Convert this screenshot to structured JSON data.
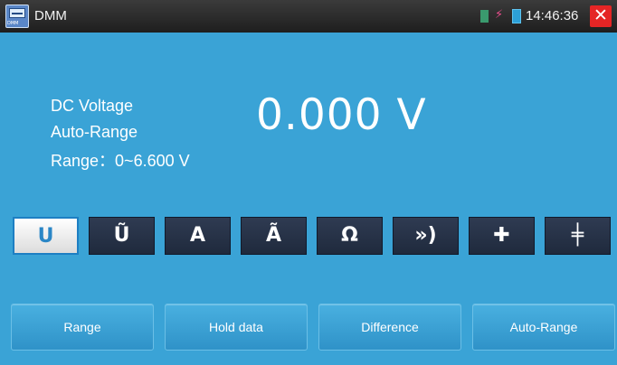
{
  "status_bar": {
    "app_icon": "multimeter-app-icon",
    "app_icon_tag": "DMM",
    "title": "DMM",
    "time": "14:46:36",
    "close_label": "✕",
    "icons": [
      "sd-card-icon",
      "usb-icon",
      "battery-icon"
    ],
    "colors": {
      "close": "#e52525",
      "battery": "#2ca0d8"
    }
  },
  "measurement": {
    "mode": "DC Voltage",
    "range_mode": "Auto-Range",
    "range": "Range：0~6.600 V",
    "value": "0.000 V"
  },
  "mode_buttons": [
    {
      "glyph": "U",
      "icon": "dc-voltage-icon",
      "active": true
    },
    {
      "glyph": "Ũ",
      "icon": "ac-voltage-icon",
      "active": false
    },
    {
      "glyph": "A",
      "icon": "dc-current-icon",
      "active": false
    },
    {
      "glyph": "Ã",
      "icon": "ac-current-icon",
      "active": false
    },
    {
      "glyph": "Ω",
      "icon": "resistance-icon",
      "active": false
    },
    {
      "glyph": "»)",
      "icon": "continuity-icon",
      "active": false
    },
    {
      "glyph": "✚",
      "icon": "diode-icon",
      "active": false
    },
    {
      "glyph": "╪",
      "icon": "capacitance-icon",
      "active": false
    }
  ],
  "action_buttons": {
    "range": "Range",
    "hold": "Hold data",
    "difference": "Difference",
    "auto_range": "Auto-Range"
  },
  "colors": {
    "background": "#3aa3d6",
    "active_mode": "#2a86c6"
  }
}
